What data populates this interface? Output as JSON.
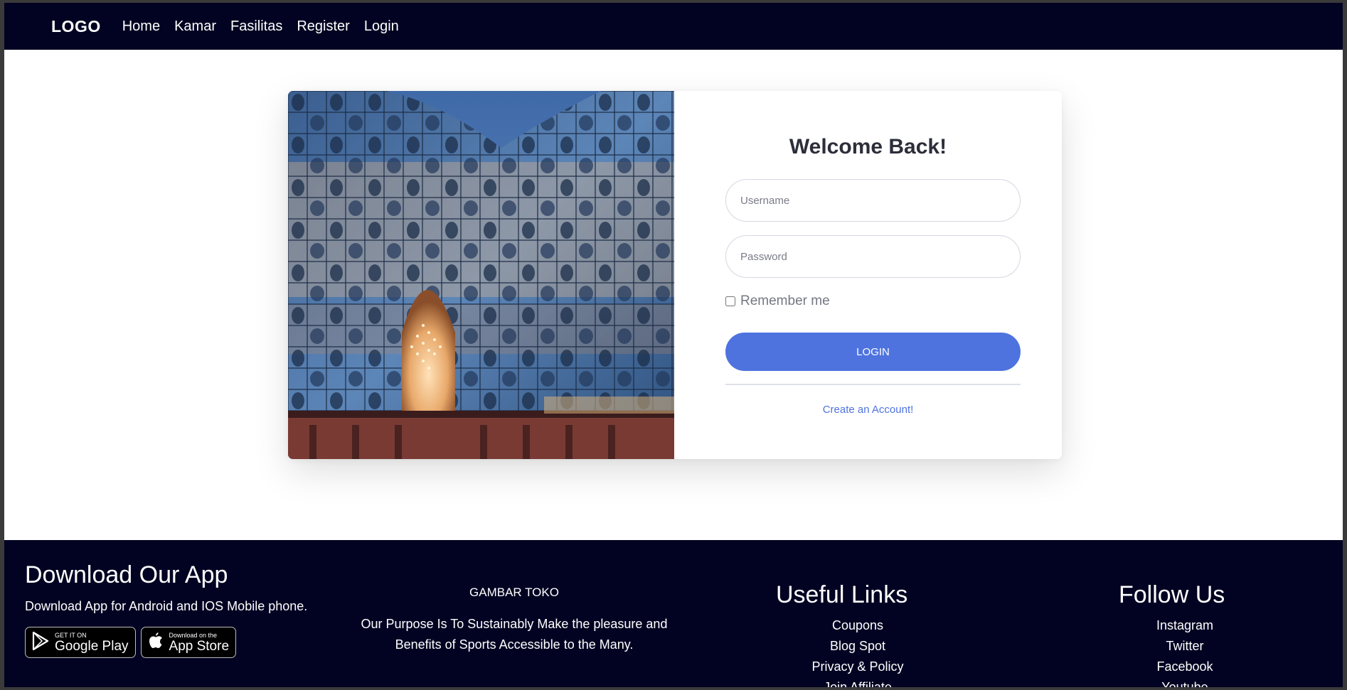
{
  "nav": {
    "logo": "LOGO",
    "links": [
      "Home",
      "Kamar",
      "Fasilitas",
      "Register",
      "Login"
    ]
  },
  "login": {
    "title": "Welcome Back!",
    "username_placeholder": "Username",
    "password_placeholder": "Password",
    "remember_label": "Remember me",
    "button_label": "LOGIN",
    "create_account": "Create an Account!"
  },
  "footer": {
    "download": {
      "title": "Download Our App",
      "subtitle": "Download App for Android and IOS Mobile phone.",
      "google_small": "GET IT ON",
      "google_big": "Google Play",
      "apple_small": "Download on the",
      "apple_big": "App Store"
    },
    "brand": {
      "name": "GAMBAR TOKO",
      "description": "Our Purpose Is To Sustainably Make the pleasure and Benefits of Sports Accessible to the Many."
    },
    "useful_links": {
      "title": "Useful Links",
      "items": [
        "Coupons",
        "Blog Spot",
        "Privacy & Policy",
        "Join Affiliate"
      ]
    },
    "follow": {
      "title": "Follow Us",
      "items": [
        "Instagram",
        "Twitter",
        "Facebook",
        "Youtube"
      ]
    }
  },
  "colors": {
    "nav_bg": "#020322",
    "accent": "#4e73df",
    "footer_bg": "#020322"
  }
}
